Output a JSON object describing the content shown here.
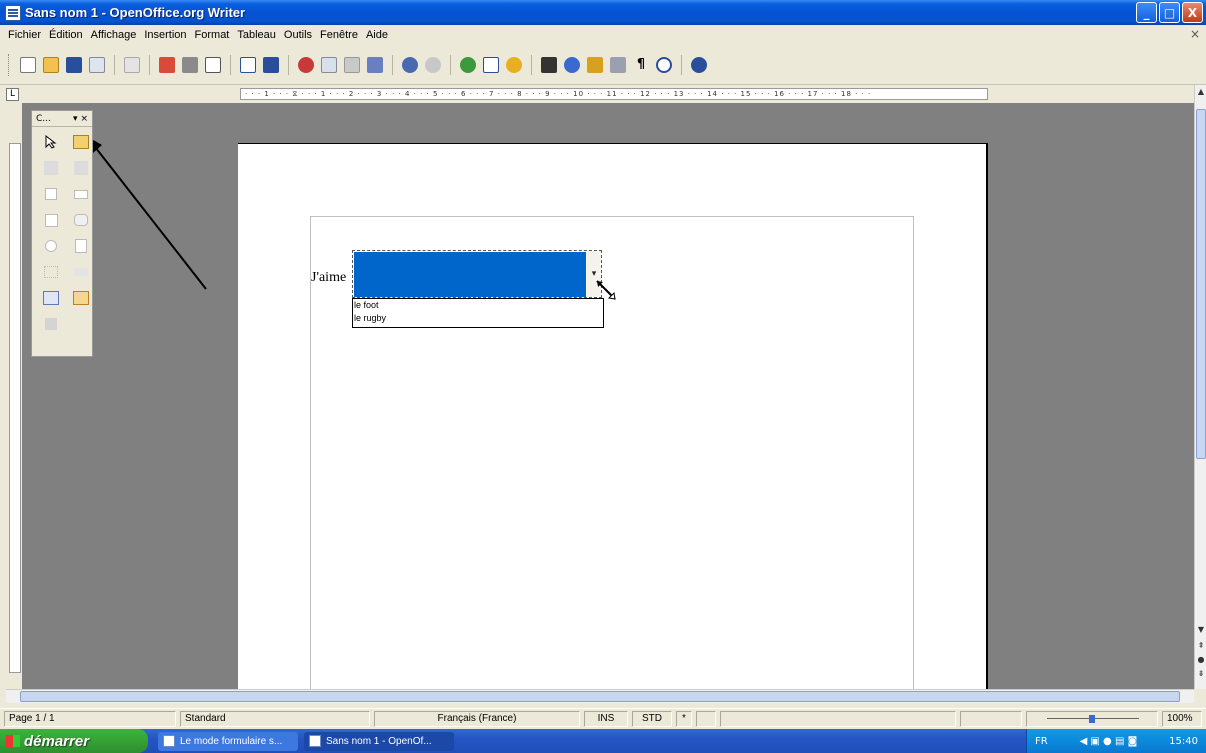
{
  "window": {
    "title": "Sans nom 1 - OpenOffice.org Writer",
    "buttons": {
      "minimize": "_",
      "maximize": "□",
      "close": "X"
    }
  },
  "menubar": {
    "items": [
      "Fichier",
      "Édition",
      "Affichage",
      "Insertion",
      "Format",
      "Tableau",
      "Outils",
      "Fenêtre",
      "Aide"
    ],
    "close_glyph": "×"
  },
  "toolbar": {
    "icons": [
      "new-icon",
      "open-icon",
      "save-icon",
      "email-icon",
      "edit-icon",
      "pdf-icon",
      "print-icon",
      "preview-icon",
      "spellcheck-icon",
      "autospell-icon",
      "cut-icon",
      "copy-icon",
      "paste-icon",
      "format-paintbrush-icon",
      "undo-icon",
      "redo-icon",
      "hyperlink-icon",
      "table-icon",
      "draw-icon",
      "find-icon",
      "navigator-icon",
      "gallery-icon",
      "datasource-icon",
      "nonprinting-chars-icon",
      "zoom-icon",
      "help-icon"
    ]
  },
  "ruler": {
    "text": "· · · 1 · · · ⧖ · · · 1 · · · 2 · · · 3 · · · 4 · · · 5 · · · 6 · · · 7 · · · 8 · · · 9 · · · 10 · · · 11 · · · 12 · · · 13 · · · 14 · · · 15 · · · 16 · · · 17 · · · 18 · · ·",
    "corner": "L"
  },
  "form_toolbar": {
    "title": "C...",
    "menu_glyph": "▾",
    "close_glyph": "×"
  },
  "document": {
    "label": "J'aime",
    "combo_arrow": "▾",
    "options": [
      "le foot",
      "le rugby"
    ]
  },
  "statusbar": {
    "page": "Page 1 / 1",
    "style": "Standard",
    "language": "Français (France)",
    "insert_mode": "INS",
    "selection_mode": "STD",
    "modified": "*",
    "zoom": "100%"
  },
  "taskbar": {
    "start_label": "démarrer",
    "tasks": [
      "Le mode formulaire s...",
      "Sans nom 1 - OpenOf..."
    ],
    "language": "FR",
    "clock": "15:40"
  }
}
